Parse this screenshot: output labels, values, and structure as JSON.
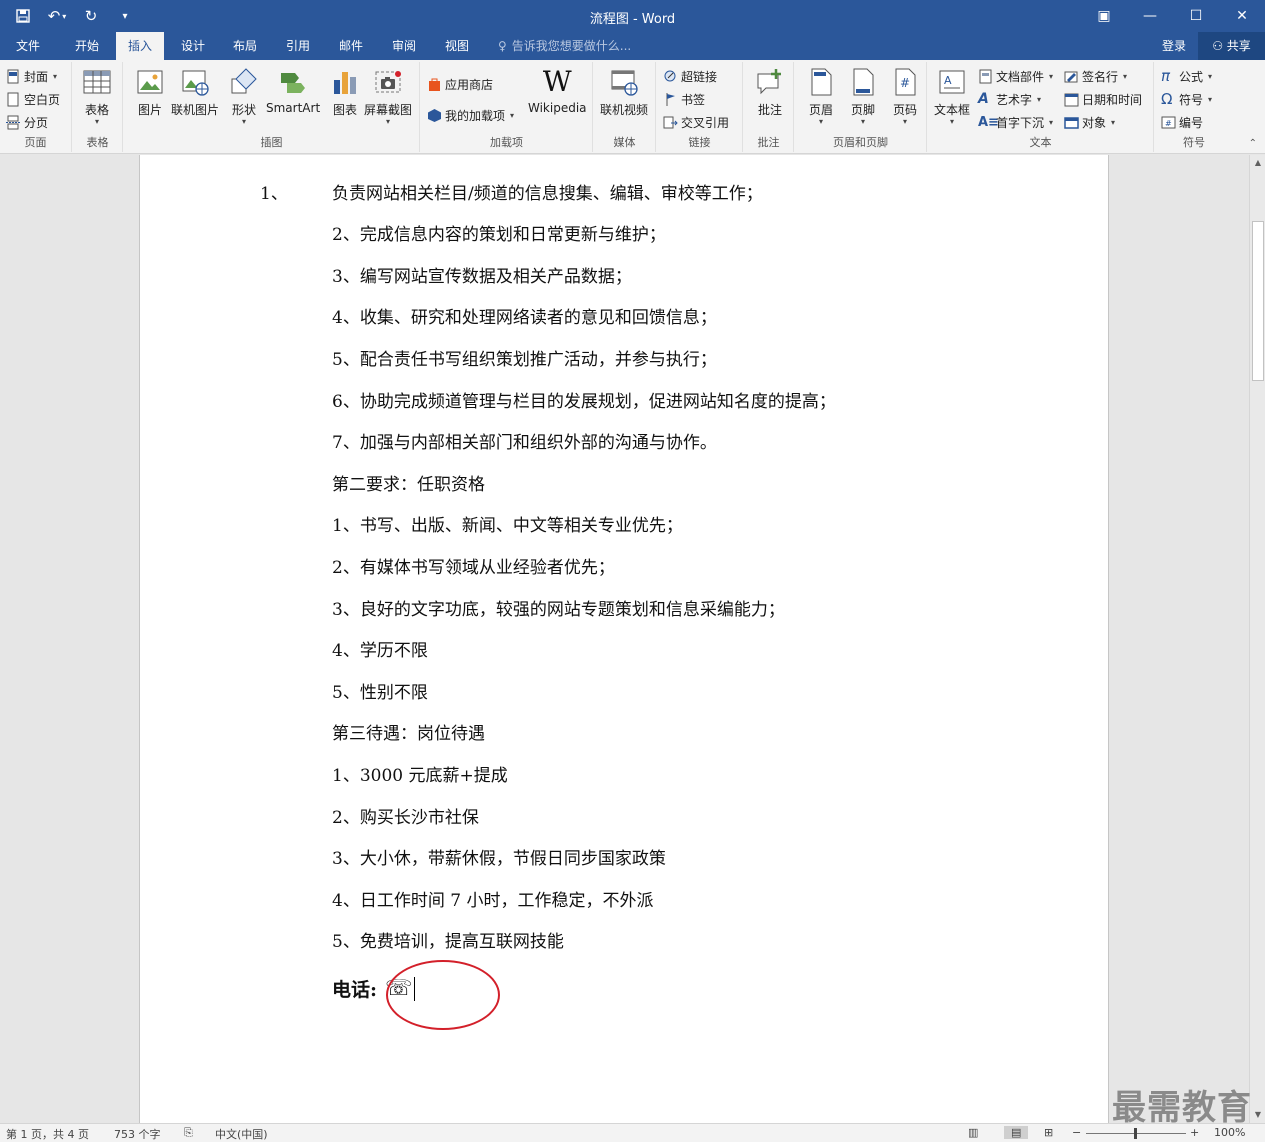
{
  "window": {
    "title": "流程图 - Word"
  },
  "tabs": [
    {
      "label": "文件"
    },
    {
      "label": "开始"
    },
    {
      "label": "插入"
    },
    {
      "label": "设计"
    },
    {
      "label": "布局"
    },
    {
      "label": "引用"
    },
    {
      "label": "邮件"
    },
    {
      "label": "审阅"
    },
    {
      "label": "视图"
    }
  ],
  "tellme": {
    "placeholder": "告诉我您想要做什么..."
  },
  "account": {
    "login": "登录",
    "share": "共享"
  },
  "ribbon": {
    "page": {
      "cover": "封面",
      "blank": "空白页",
      "break": "分页",
      "label": "页面"
    },
    "table": {
      "table": "表格",
      "label": "表格"
    },
    "illustrations": {
      "picture": "图片",
      "online_picture": "联机图片",
      "shapes": "形状",
      "smartart": "SmartArt",
      "chart": "图表",
      "screenshot": "屏幕截图",
      "label": "插图"
    },
    "addins": {
      "store": "应用商店",
      "my_addins": "我的加载项",
      "wikipedia": "Wikipedia",
      "label": "加载项"
    },
    "media": {
      "online_video": "联机视频",
      "label": "媒体"
    },
    "links": {
      "hyperlink": "超链接",
      "bookmark": "书签",
      "crossref": "交叉引用",
      "label": "链接"
    },
    "comments": {
      "comment": "批注",
      "label": "批注"
    },
    "headerfooter": {
      "header": "页眉",
      "footer": "页脚",
      "pagenum": "页码",
      "label": "页眉和页脚"
    },
    "text": {
      "textbox": "文本框",
      "quickparts": "文档部件",
      "wordart": "艺术字",
      "dropcap": "首字下沉",
      "signature": "签名行",
      "datetime": "日期和时间",
      "object": "对象",
      "label": "文本"
    },
    "symbols": {
      "equation": "公式",
      "symbol": "符号",
      "number": "编号",
      "label": "符号"
    }
  },
  "document": {
    "first_number": "1、",
    "first_text": "负责网站相关栏目/频道的信息搜集、编辑、审校等工作；",
    "paragraphs": [
      "2、完成信息内容的策划和日常更新与维护；",
      "3、编写网站宣传数据及相关产品数据；",
      "4、收集、研究和处理网络读者的意见和回馈信息；",
      "5、配合责任书写组织策划推广活动，并参与执行；",
      "6、协助完成频道管理与栏目的发展规划，促进网站知名度的提高；",
      "7、加强与内部相关部门和组织外部的沟通与协作。",
      "第二要求：任职资格",
      "1、书写、出版、新闻、中文等相关专业优先；",
      "2、有媒体书写领域从业经验者优先；",
      "3、良好的文字功底，较强的网站专题策划和信息采编能力；",
      "4、学历不限",
      "5、性别不限",
      "第三待遇：岗位待遇",
      "1、3000 元底薪+提成",
      "2、购买长沙市社保",
      "3、大小休，带薪休假，节假日同步国家政策",
      "4、日工作时间 7 小时，工作稳定，不外派",
      "5、免费培训，提高互联网技能"
    ],
    "phone_label": "电话:",
    "phone_symbol": "☏"
  },
  "status": {
    "page": "第 1 页，共 4 页",
    "words": "753 个字",
    "language": "中文(中国)",
    "zoom": "100%"
  },
  "watermark": "最需教育",
  "colors": {
    "accent": "#2b579a",
    "annotation": "#d3202a"
  }
}
